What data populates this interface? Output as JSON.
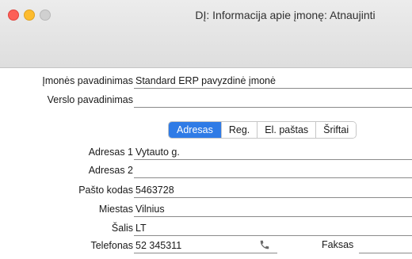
{
  "window": {
    "title": "DĮ: Informacija apie įmonę: Atnaujinti"
  },
  "company": {
    "name_label": "Įmonės pavadinimas",
    "name_value": "Standard ERP pavyzdinė įmonė",
    "business_label": "Verslo pavadinimas",
    "business_value": ""
  },
  "tabs": [
    "Adresas",
    "Reg.",
    "El. paštas",
    "Šriftai"
  ],
  "active_tab": "Adresas",
  "address": {
    "addr1_label": "Adresas 1",
    "addr1_value": "Vytauto g.",
    "addr2_label": "Adresas 2",
    "addr2_value": "",
    "postal_label": "Pašto kodas",
    "postal_value": "5463728",
    "city_label": "Miestas",
    "city_value": "Vilnius",
    "country_label": "Šalis",
    "country_value": "LT",
    "phone_label": "Telefonas",
    "phone_value": "52 345311",
    "fax_label": "Faksas",
    "fax_value": ""
  },
  "icons": {
    "phone": "phone-icon"
  },
  "colors": {
    "active_tab": "#2f7be6",
    "close": "#fc5f57",
    "minimize": "#fdbc2e"
  }
}
